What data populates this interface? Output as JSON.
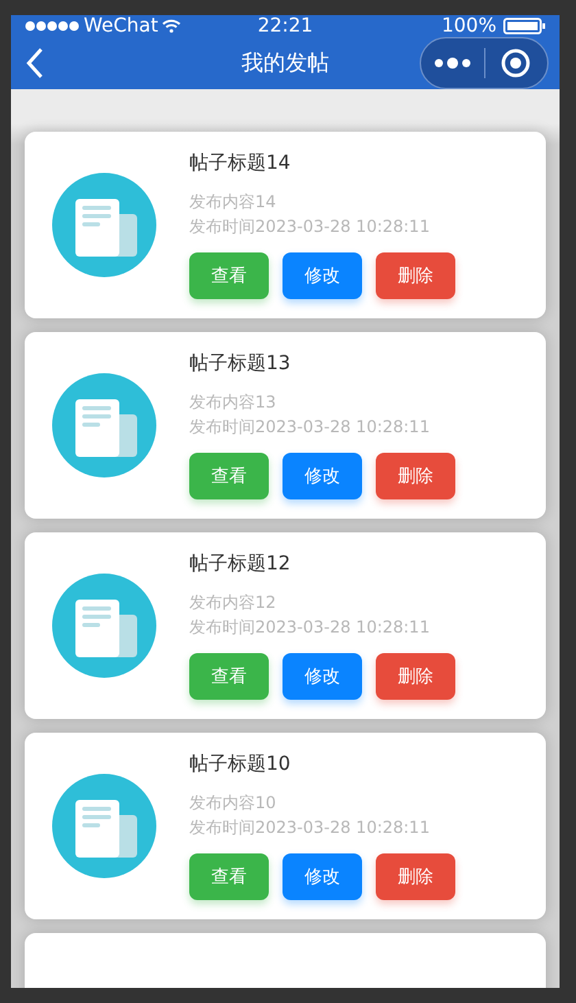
{
  "status_bar": {
    "carrier": "WeChat",
    "time": "22:21",
    "battery": "100%"
  },
  "nav": {
    "title": "我的发帖"
  },
  "posts": [
    {
      "title": "帖子标题14",
      "content": "发布内容14",
      "time": "发布时间2023-03-28 10:28:11",
      "buttons": [
        {
          "kind": "view",
          "label": "查看"
        },
        {
          "kind": "edit",
          "label": "修改"
        },
        {
          "kind": "delete",
          "label": "删除"
        }
      ]
    },
    {
      "title": "帖子标题13",
      "content": "发布内容13",
      "time": "发布时间2023-03-28 10:28:11",
      "buttons": [
        {
          "kind": "view",
          "label": "查看"
        },
        {
          "kind": "edit",
          "label": "修改"
        },
        {
          "kind": "delete",
          "label": "删除"
        }
      ]
    },
    {
      "title": "帖子标题12",
      "content": "发布内容12",
      "time": "发布时间2023-03-28 10:28:11",
      "buttons": [
        {
          "kind": "view",
          "label": "查看"
        },
        {
          "kind": "edit",
          "label": "修改"
        },
        {
          "kind": "delete",
          "label": "删除"
        }
      ]
    },
    {
      "title": "帖子标题10",
      "content": "发布内容10",
      "time": "发布时间2023-03-28 10:28:11",
      "buttons": [
        {
          "kind": "view",
          "label": "查看"
        },
        {
          "kind": "edit",
          "label": "修改"
        },
        {
          "kind": "delete",
          "label": "删除"
        }
      ]
    }
  ]
}
